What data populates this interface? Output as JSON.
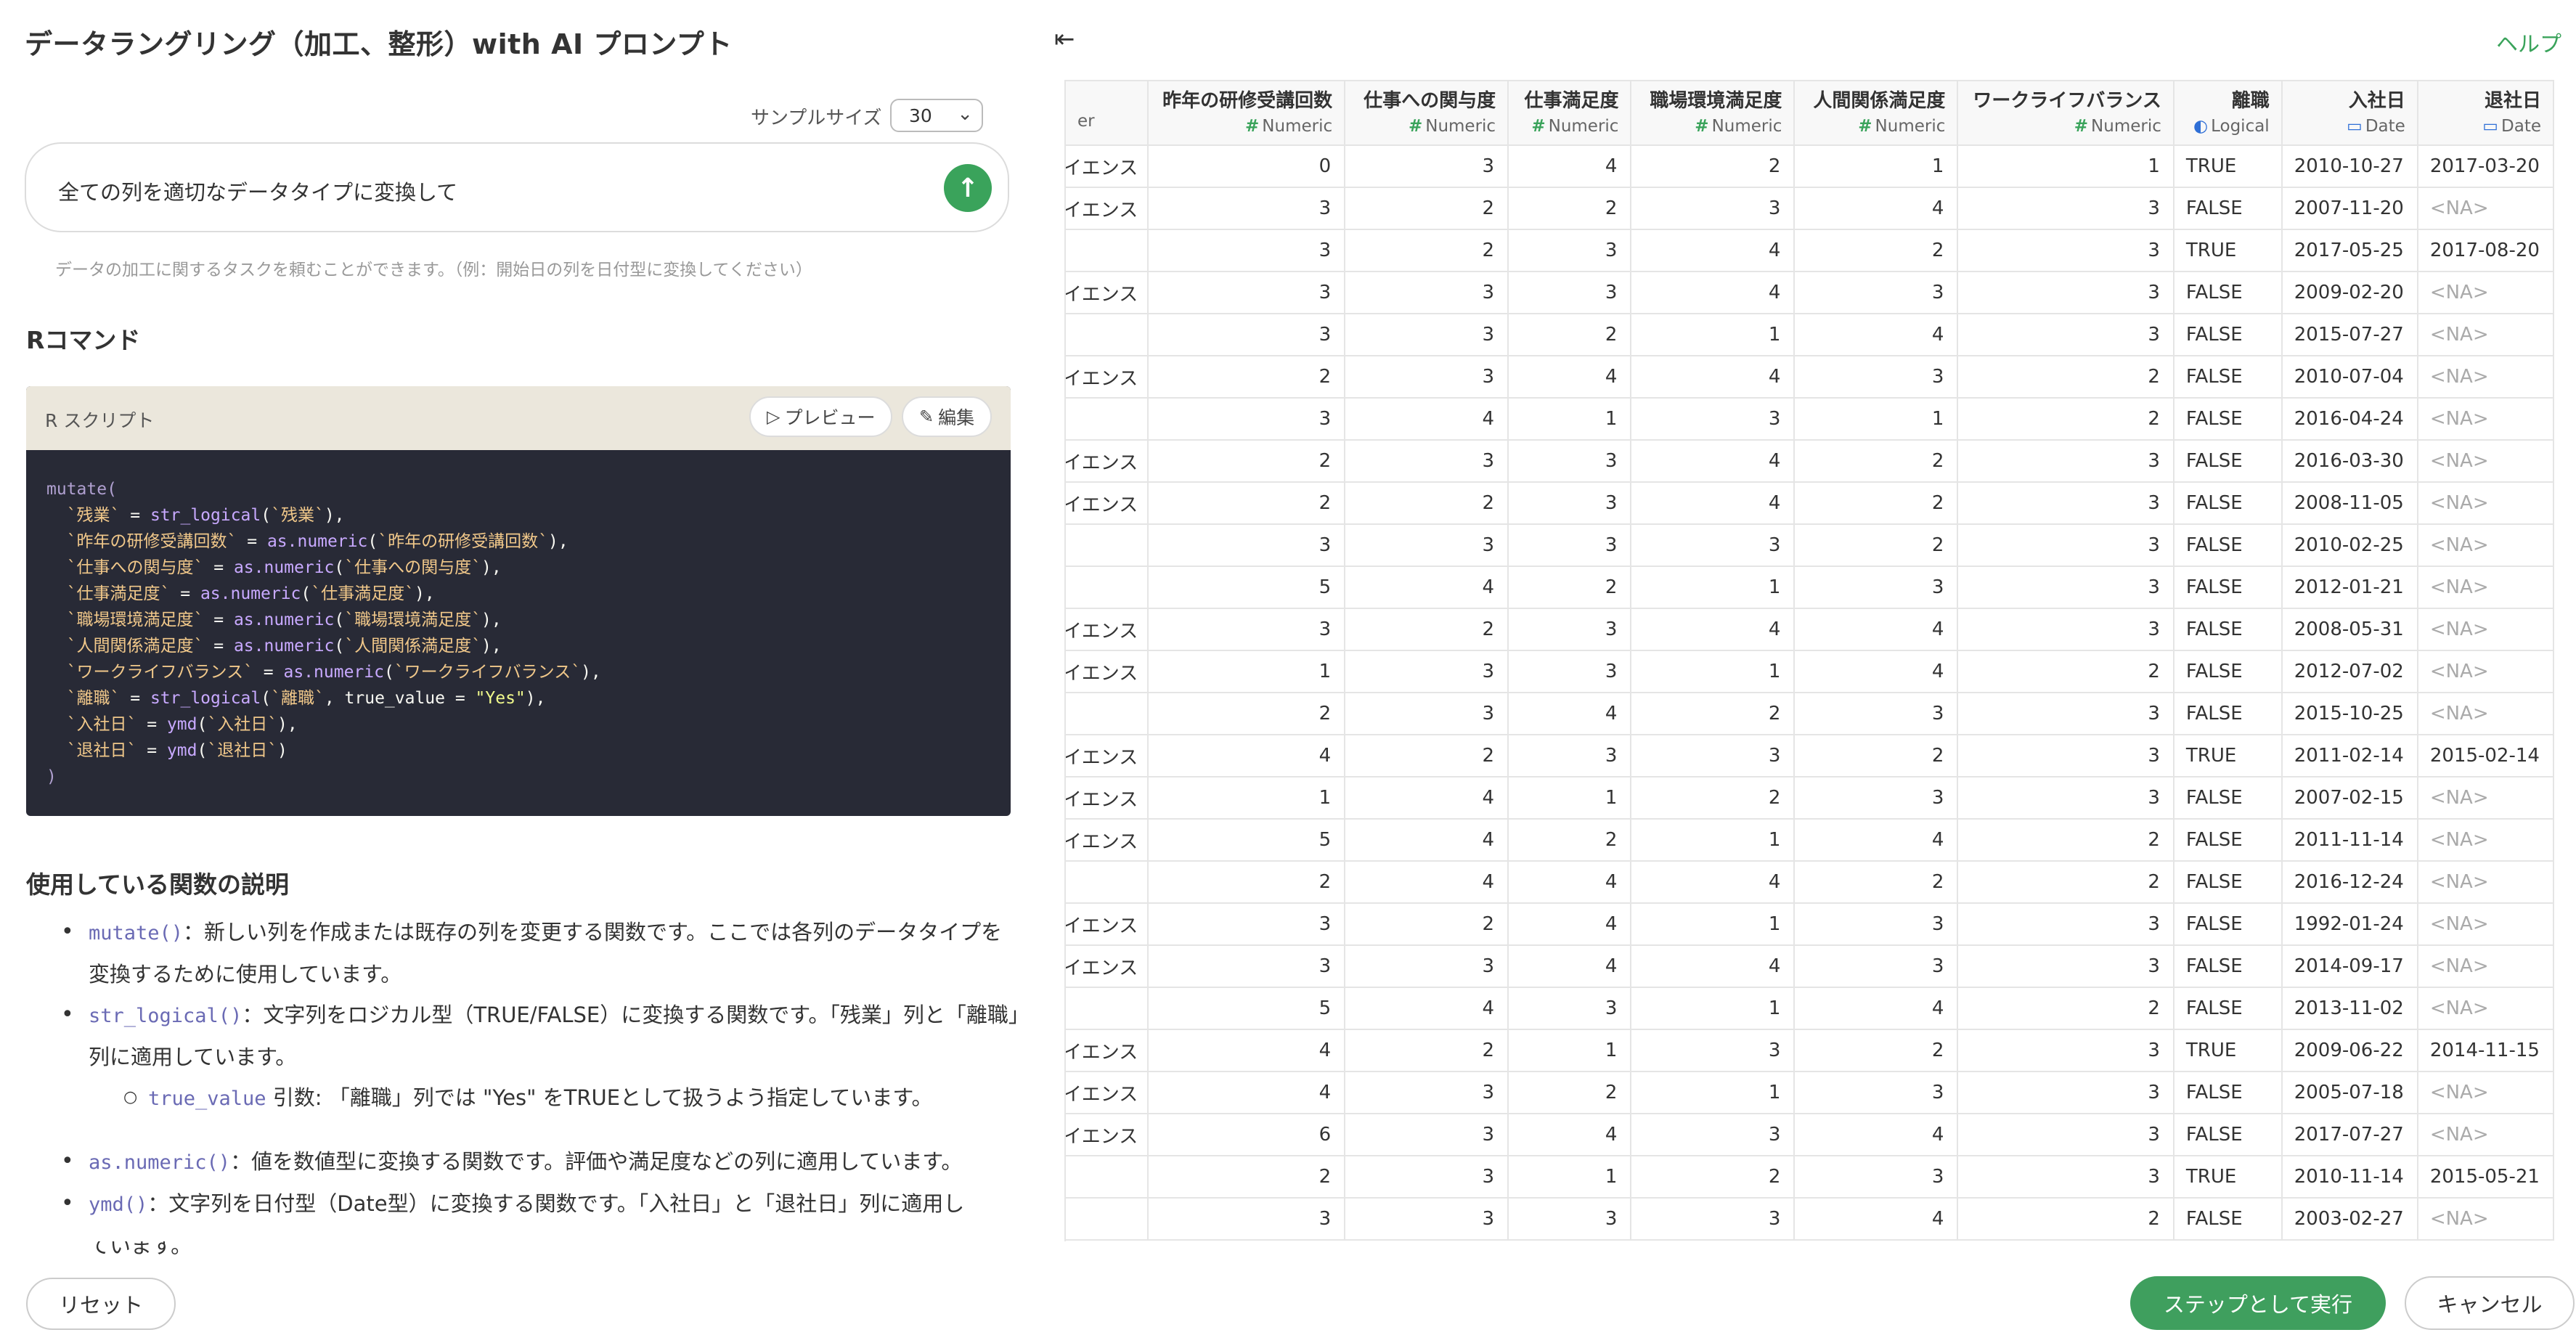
{
  "left": {
    "title": "データラングリング（加工、整形）with AI プロンプト",
    "sample_size_label": "サンプルサイズ",
    "sample_size_value": "30",
    "prompt_text": "全ての列を適切なデータタイプに変換して",
    "hint": "データの加工に関するタスクを頼むことができます。（例：開始日の列を日付型に変換してください）",
    "r_command_title": "Rコマンド",
    "code_header": "R スクリプト",
    "preview_label": "プレビュー",
    "edit_label": "編集",
    "code": {
      "l1": "mutate(",
      "l2a": "  `残業`",
      "l2b": " = ",
      "l2c": "str_logical",
      "l2d": "(",
      "l2e": "`残業`",
      "l2f": "),",
      "l3a": "  `昨年の研修受講回数`",
      "l3c": "as.numeric",
      "l3e": "`昨年の研修受講回数`",
      "l4a": "  `仕事への関与度`",
      "l4e": "`仕事への関与度`",
      "l5a": "  `仕事満足度`",
      "l5e": "`仕事満足度`",
      "l6a": "  `職場環境満足度`",
      "l6e": "`職場環境満足度`",
      "l7a": "  `人間関係満足度`",
      "l7e": "`人間関係満足度`",
      "l8a": "  `ワークライフバランス`",
      "l8e": "`ワークライフバランス`",
      "l9a": "  `離職`",
      "l9e": "`離職`",
      "l9g": ", true_value = ",
      "l9h": "\"Yes\"",
      "l10a": "  `入社日`",
      "l10c": "ymd",
      "l10e": "`入社日`",
      "l11a": "  `退社日`",
      "l11e": "`退社日`",
      "l12": ")"
    },
    "functions_title": "使用している関数の説明",
    "desc": {
      "mutate_fn": "mutate()",
      "mutate_text": "：新しい列を作成または既存の列を変更する関数です。ここでは各列のデータタイプを変換するために使用しています。",
      "str_logical_fn": "str_logical()",
      "str_logical_text": "：文字列をロジカル型（TRUE/FALSE）に変換する関数です。「残業」列と「離職」列に適用しています。",
      "true_value_fn": "true_value",
      "true_value_text": " 引数: 「離職」列では \"Yes\" をTRUEとして扱うよう指定しています。",
      "as_numeric_fn": "as.numeric()",
      "as_numeric_text": "：値を数値型に変換する関数です。評価や満足度などの列に適用しています。",
      "ymd_fn": "ymd()",
      "ymd_text": "：文字列を日付型（Date型）に変換する関数です。「入社日」と「退社日」列に適用し",
      "ymd_text2": "ています。"
    },
    "reset_label": "リセット"
  },
  "right": {
    "collapse_icon": "collapse-left-icon",
    "help_label": "ヘルプ",
    "columns": [
      {
        "name": "",
        "type": "er"
      },
      {
        "name": "昨年の研修受講回数",
        "type": "Numeric"
      },
      {
        "name": "仕事への関与度",
        "type": "Numeric"
      },
      {
        "name": "仕事満足度",
        "type": "Numeric"
      },
      {
        "name": "職場環境満足度",
        "type": "Numeric"
      },
      {
        "name": "人間関係満足度",
        "type": "Numeric"
      },
      {
        "name": "ワークライフバランス",
        "type": "Numeric"
      },
      {
        "name": "離職",
        "type": "Logical"
      },
      {
        "name": "入社日",
        "type": "Date"
      },
      {
        "name": "退社日",
        "type": "Date"
      }
    ],
    "rows": [
      [
        "イエンス",
        "0",
        "3",
        "4",
        "2",
        "1",
        "1",
        "TRUE",
        "2010-10-27",
        "2017-03-20"
      ],
      [
        "イエンス",
        "3",
        "2",
        "2",
        "3",
        "4",
        "3",
        "FALSE",
        "2007-11-20",
        "<NA>"
      ],
      [
        "",
        "3",
        "2",
        "3",
        "4",
        "2",
        "3",
        "TRUE",
        "2017-05-25",
        "2017-08-20"
      ],
      [
        "イエンス",
        "3",
        "3",
        "3",
        "4",
        "3",
        "3",
        "FALSE",
        "2009-02-20",
        "<NA>"
      ],
      [
        "",
        "3",
        "3",
        "2",
        "1",
        "4",
        "3",
        "FALSE",
        "2015-07-27",
        "<NA>"
      ],
      [
        "イエンス",
        "2",
        "3",
        "4",
        "4",
        "3",
        "2",
        "FALSE",
        "2010-07-04",
        "<NA>"
      ],
      [
        "",
        "3",
        "4",
        "1",
        "3",
        "1",
        "2",
        "FALSE",
        "2016-04-24",
        "<NA>"
      ],
      [
        "イエンス",
        "2",
        "3",
        "3",
        "4",
        "2",
        "3",
        "FALSE",
        "2016-03-30",
        "<NA>"
      ],
      [
        "イエンス",
        "2",
        "2",
        "3",
        "4",
        "2",
        "3",
        "FALSE",
        "2008-11-05",
        "<NA>"
      ],
      [
        "",
        "3",
        "3",
        "3",
        "3",
        "2",
        "3",
        "FALSE",
        "2010-02-25",
        "<NA>"
      ],
      [
        "",
        "5",
        "4",
        "2",
        "1",
        "3",
        "3",
        "FALSE",
        "2012-01-21",
        "<NA>"
      ],
      [
        "イエンス",
        "3",
        "2",
        "3",
        "4",
        "4",
        "3",
        "FALSE",
        "2008-05-31",
        "<NA>"
      ],
      [
        "イエンス",
        "1",
        "3",
        "3",
        "1",
        "4",
        "2",
        "FALSE",
        "2012-07-02",
        "<NA>"
      ],
      [
        "",
        "2",
        "3",
        "4",
        "2",
        "3",
        "3",
        "FALSE",
        "2015-10-25",
        "<NA>"
      ],
      [
        "イエンス",
        "4",
        "2",
        "3",
        "3",
        "2",
        "3",
        "TRUE",
        "2011-02-14",
        "2015-02-14"
      ],
      [
        "イエンス",
        "1",
        "4",
        "1",
        "2",
        "3",
        "3",
        "FALSE",
        "2007-02-15",
        "<NA>"
      ],
      [
        "イエンス",
        "5",
        "4",
        "2",
        "1",
        "4",
        "2",
        "FALSE",
        "2011-11-14",
        "<NA>"
      ],
      [
        "",
        "2",
        "4",
        "4",
        "4",
        "2",
        "2",
        "FALSE",
        "2016-12-24",
        "<NA>"
      ],
      [
        "イエンス",
        "3",
        "2",
        "4",
        "1",
        "3",
        "3",
        "FALSE",
        "1992-01-24",
        "<NA>"
      ],
      [
        "イエンス",
        "3",
        "3",
        "4",
        "4",
        "3",
        "3",
        "FALSE",
        "2014-09-17",
        "<NA>"
      ],
      [
        "",
        "5",
        "4",
        "3",
        "1",
        "4",
        "2",
        "FALSE",
        "2013-11-02",
        "<NA>"
      ],
      [
        "イエンス",
        "4",
        "2",
        "1",
        "3",
        "2",
        "3",
        "TRUE",
        "2009-06-22",
        "2014-11-15"
      ],
      [
        "イエンス",
        "4",
        "3",
        "2",
        "1",
        "3",
        "3",
        "FALSE",
        "2005-07-18",
        "<NA>"
      ],
      [
        "イエンス",
        "6",
        "3",
        "4",
        "3",
        "4",
        "3",
        "FALSE",
        "2017-07-27",
        "<NA>"
      ],
      [
        "",
        "2",
        "3",
        "1",
        "2",
        "3",
        "3",
        "TRUE",
        "2010-11-14",
        "2015-05-21"
      ],
      [
        "",
        "3",
        "3",
        "3",
        "3",
        "4",
        "2",
        "FALSE",
        "2003-02-27",
        "<NA>"
      ]
    ],
    "run_label": "ステップとして実行",
    "cancel_label": "キャンセル"
  }
}
